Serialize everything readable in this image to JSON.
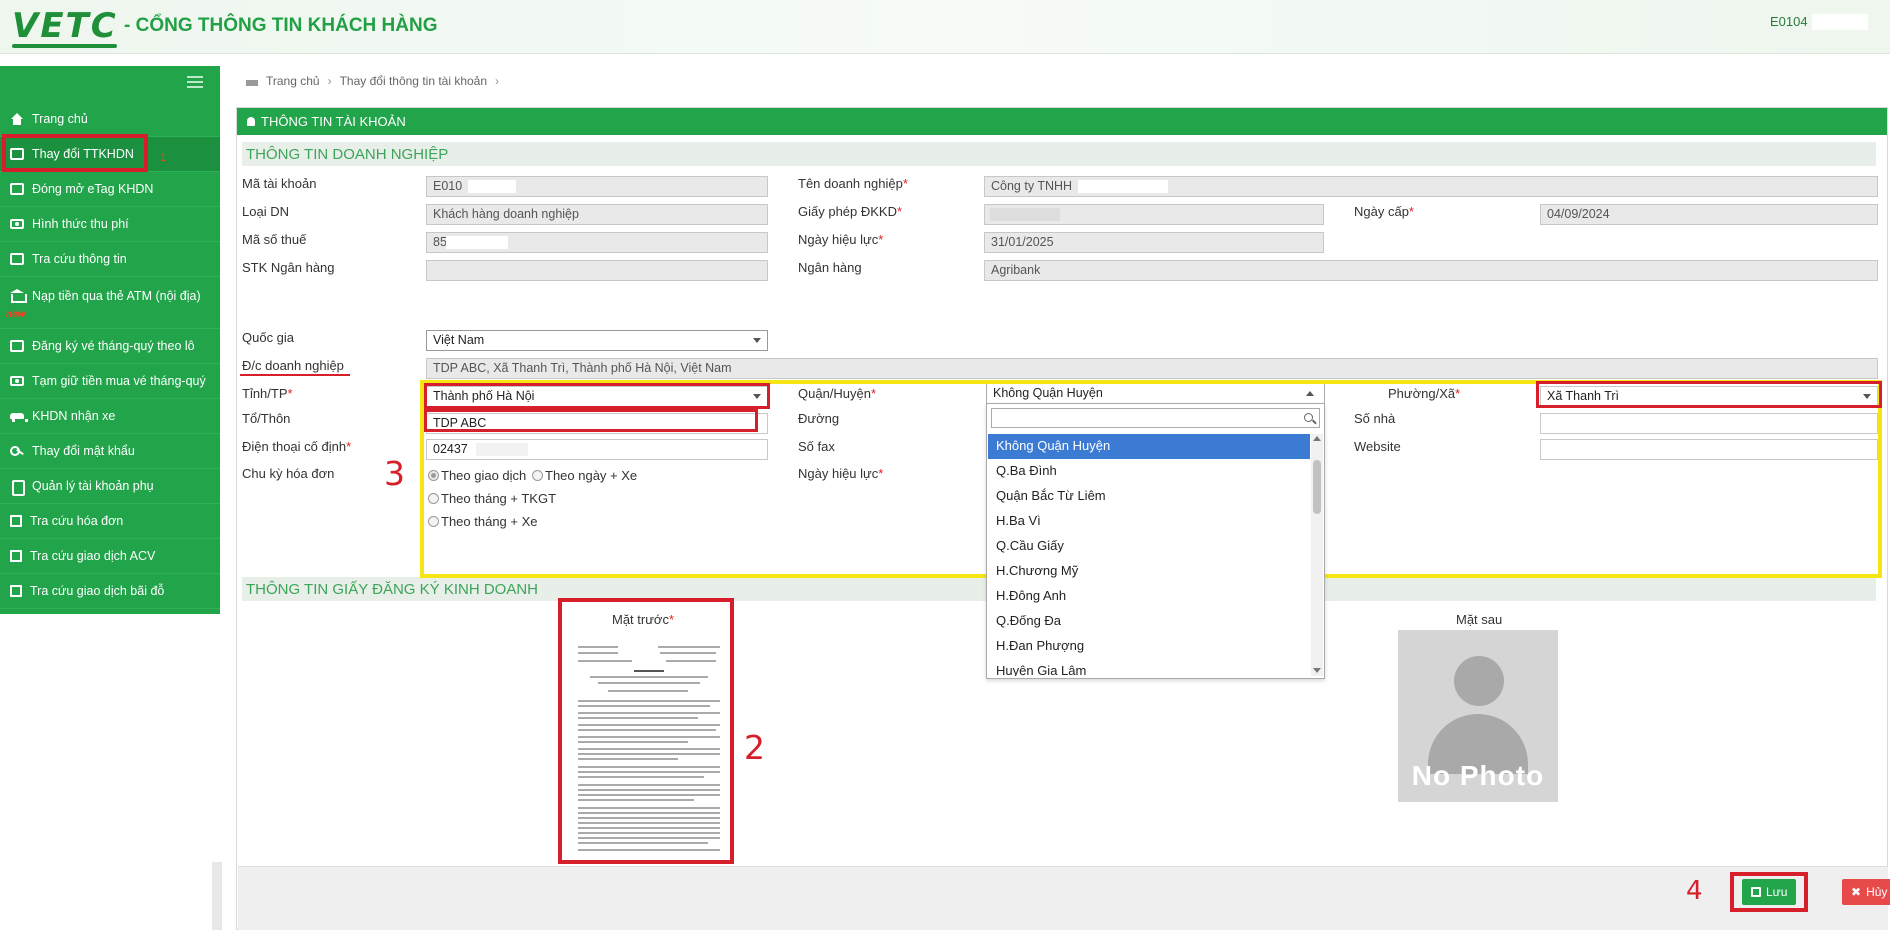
{
  "header": {
    "logo_text": "VETC",
    "portal_title": "- CỔNG THÔNG TIN KHÁCH HÀNG",
    "user_id": "E0104"
  },
  "sidebar": {
    "items": [
      {
        "label": "Trang chủ",
        "icon": "home-icon"
      },
      {
        "label": "Thay đổi TTKHDN",
        "icon": "list-icon"
      },
      {
        "label": "Đóng mở eTag KHDN",
        "icon": "list-icon"
      },
      {
        "label": "Hình thức thu phí",
        "icon": "cash-icon"
      },
      {
        "label": "Tra cứu thông tin",
        "icon": "search-doc-icon"
      },
      {
        "label": "Nạp tiền qua thẻ ATM (nội địa)",
        "icon": "bank-icon",
        "badge": "new"
      },
      {
        "label": "Đăng ký vé tháng-quý theo lô",
        "icon": "list-icon"
      },
      {
        "label": "Tạm giữ tiền mua vé tháng-quý",
        "icon": "cash-icon"
      },
      {
        "label": "KHDN nhận xe",
        "icon": "car-icon"
      },
      {
        "label": "Thay đổi mật khẩu",
        "icon": "key-icon"
      },
      {
        "label": "Quản lý tài khoản phụ",
        "icon": "phone-icon"
      },
      {
        "label": "Tra cứu hóa đơn",
        "icon": "document-icon"
      },
      {
        "label": "Tra cứu giao dịch ACV",
        "icon": "document-icon"
      },
      {
        "label": "Tra cứu giao dịch bãi đỗ",
        "icon": "document-icon"
      }
    ]
  },
  "breadcrumb": {
    "home": "Trang chủ",
    "current": "Thay đổi thông tin tài khoản"
  },
  "panel": {
    "title": "THÔNG TIN TÀI KHOẢN"
  },
  "business_section": {
    "title": "THÔNG TIN DOANH NGHIỆP",
    "account_id": {
      "label": "Mã tài khoản",
      "value": "E010"
    },
    "type": {
      "label": "Loại DN",
      "value": "Khách hàng doanh nghiệp"
    },
    "tax_code": {
      "label": "Mã số thuế",
      "value": "85"
    },
    "bank_account": {
      "label": "STK Ngân hàng",
      "value": ""
    },
    "company_name": {
      "label": "Tên doanh nghiệp",
      "value": "Công ty TNHH"
    },
    "license": {
      "label": "Giấy phép ĐKKD",
      "value": ""
    },
    "effective_date": {
      "label": "Ngày hiệu lực",
      "value": "31/01/2025"
    },
    "bank": {
      "label": "Ngân hàng",
      "value": "Agribank"
    },
    "issue_date": {
      "label": "Ngày cấp",
      "value": "04/09/2024"
    },
    "country": {
      "label": "Quốc gia",
      "value": "Việt Nam"
    },
    "address": {
      "label": "Đ/c doanh nghiệp",
      "value": "TDP ABC, Xã Thanh Trì, Thành phố Hà Nội, Việt Nam"
    },
    "province": {
      "label": "Tỉnh/TP",
      "value": "Thành phố Hà Nội"
    },
    "hamlet": {
      "label": "Tổ/Thôn",
      "value": "TDP ABC"
    },
    "phone": {
      "label": "Điện thoại cố định",
      "value": "02437"
    },
    "billing_cycle": {
      "label": "Chu kỳ hóa đơn",
      "options": [
        "Theo giao dịch",
        "Theo ngày + Xe",
        "Theo tháng + TKGT",
        "Theo tháng + Xe"
      ]
    },
    "district": {
      "label": "Quận/Huyện",
      "value": "Không Quận Huyện"
    },
    "street": {
      "label": "Đường",
      "value": ""
    },
    "fax": {
      "label": "Số fax",
      "value": ""
    },
    "effective_date2": {
      "label": "Ngày hiệu lực",
      "value": ""
    },
    "ward": {
      "label": "Phường/Xã",
      "value": "Xã Thanh Trì"
    },
    "house_no": {
      "label": "Số nhà",
      "value": ""
    },
    "website": {
      "label": "Website",
      "value": ""
    }
  },
  "district_dropdown": {
    "options": [
      "Không Quận Huyện",
      "Q.Ba Đình",
      "Quận Bắc Từ Liêm",
      "H.Ba Vì",
      "Q.Cầu Giấy",
      "H.Chương Mỹ",
      "H.Đông Anh",
      "Q.Đống Đa",
      "H.Đan Phượng",
      "Huyện Gia Lâm"
    ]
  },
  "license_section": {
    "title": "THÔNG TIN GIẤY ĐĂNG KÝ KINH DOANH",
    "front_label": "Mặt trước",
    "back_label": "Mặt sau",
    "no_photo_text": "No Photo"
  },
  "footer": {
    "save_label": "Lưu",
    "cancel_label": "Hủy"
  },
  "annotations": {
    "n1": "1",
    "n2": "2",
    "n3": "3",
    "n4": "4"
  },
  "colors": {
    "primary_green": "#21a44a",
    "highlight_red": "#d61f2a",
    "highlight_yellow": "#f4e513",
    "selected_blue": "#3b7bd4"
  }
}
